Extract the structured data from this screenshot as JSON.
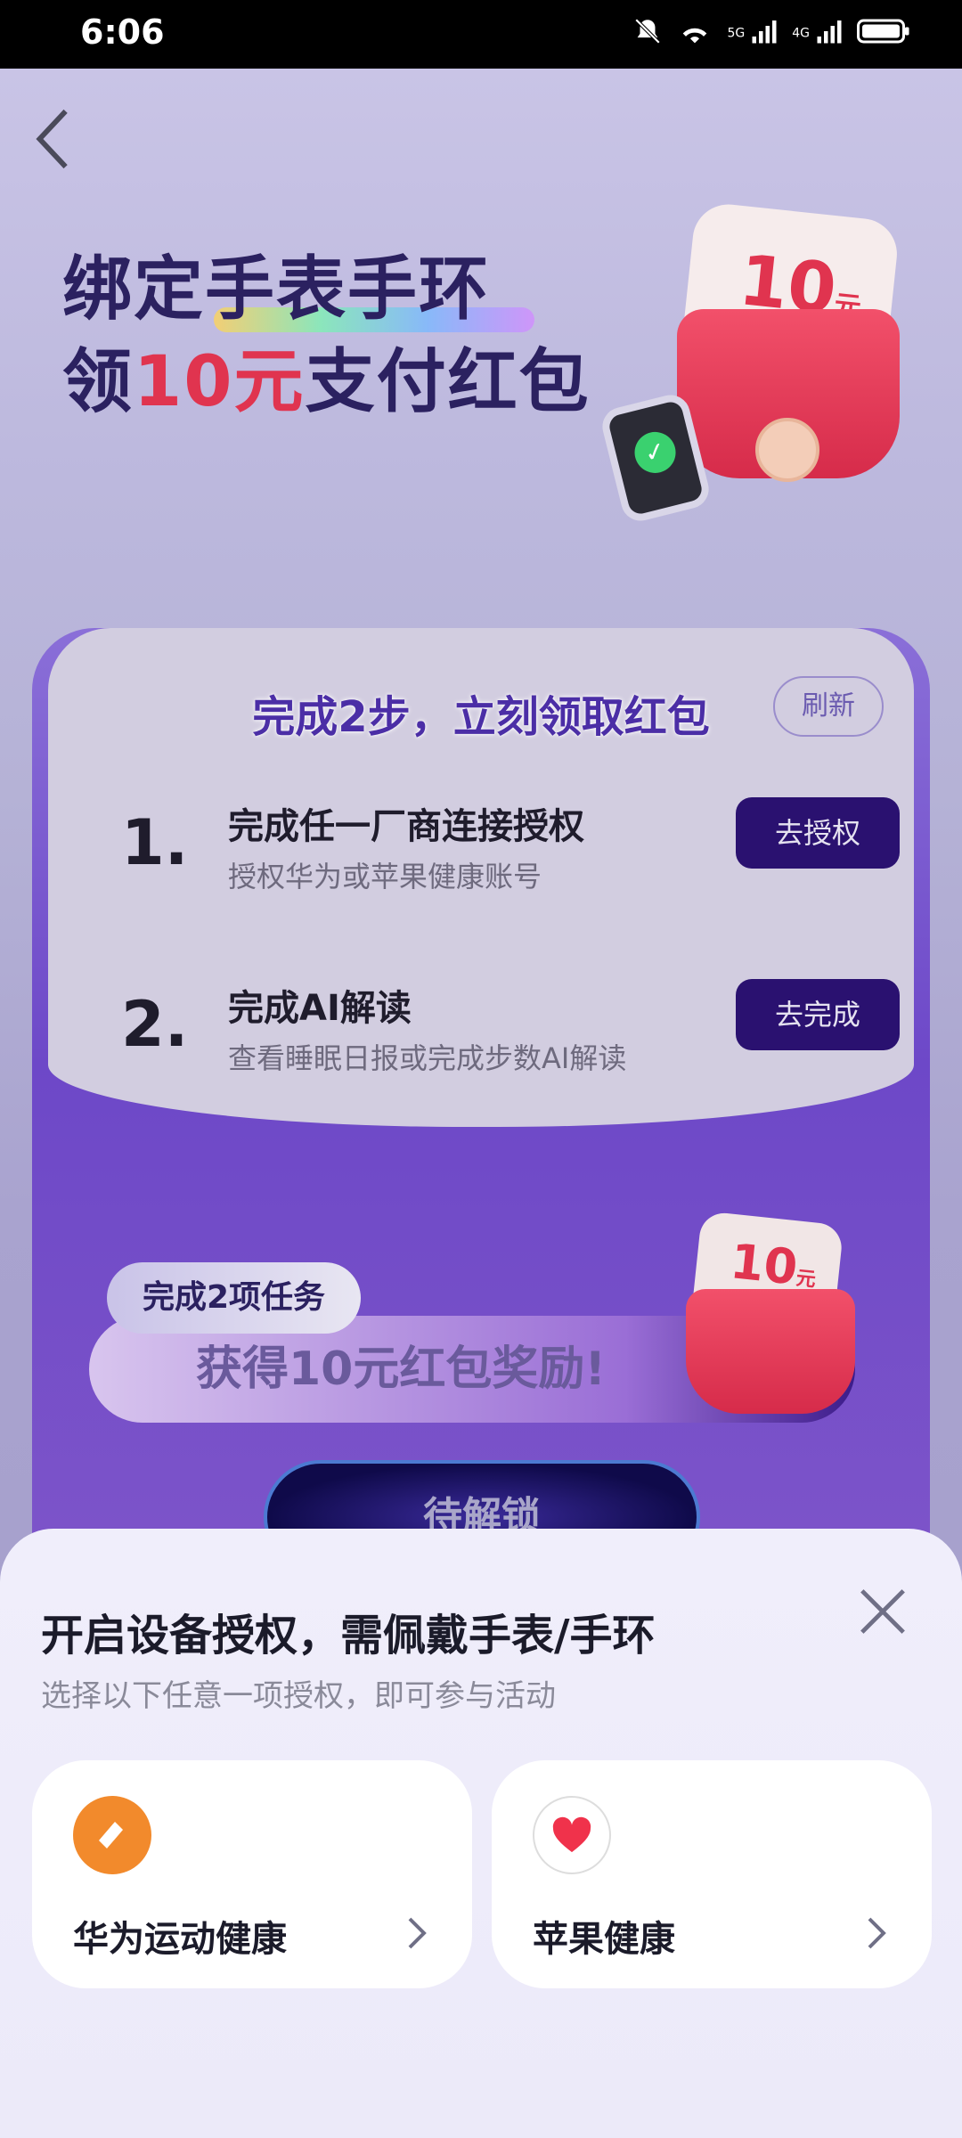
{
  "status_bar": {
    "time": "6:06",
    "network1": "5G",
    "network2": "4G"
  },
  "hero": {
    "line1": "绑定手表手环",
    "line2_prefix": "领",
    "line2_amount": "10元",
    "line2_suffix": "支付红包",
    "bag_amount": "10",
    "bag_unit": "元"
  },
  "task_card": {
    "title": "完成2步，立刻领取红包",
    "refresh_label": "刷新",
    "steps": [
      {
        "num": "1.",
        "title": "完成任一厂商连接授权",
        "desc": "授权华为或苹果健康账号",
        "action": "去授权"
      },
      {
        "num": "2.",
        "title": "完成AI解读",
        "desc": "查看睡眠日报或完成步数AI解读",
        "action": "去完成"
      }
    ],
    "reward_tag": "完成2项任务",
    "reward_text": "获得10元红包奖励!",
    "reward_bag_amount": "10",
    "reward_bag_unit": "元",
    "unlock_label": "待解锁"
  },
  "sheet": {
    "title": "开启设备授权，需佩戴手表/手环",
    "subtitle": "选择以下任意一项授权，即可参与活动",
    "options": [
      {
        "label": "华为运动健康",
        "icon": "huawei-health-icon"
      },
      {
        "label": "苹果健康",
        "icon": "apple-health-heart-icon"
      }
    ]
  }
}
